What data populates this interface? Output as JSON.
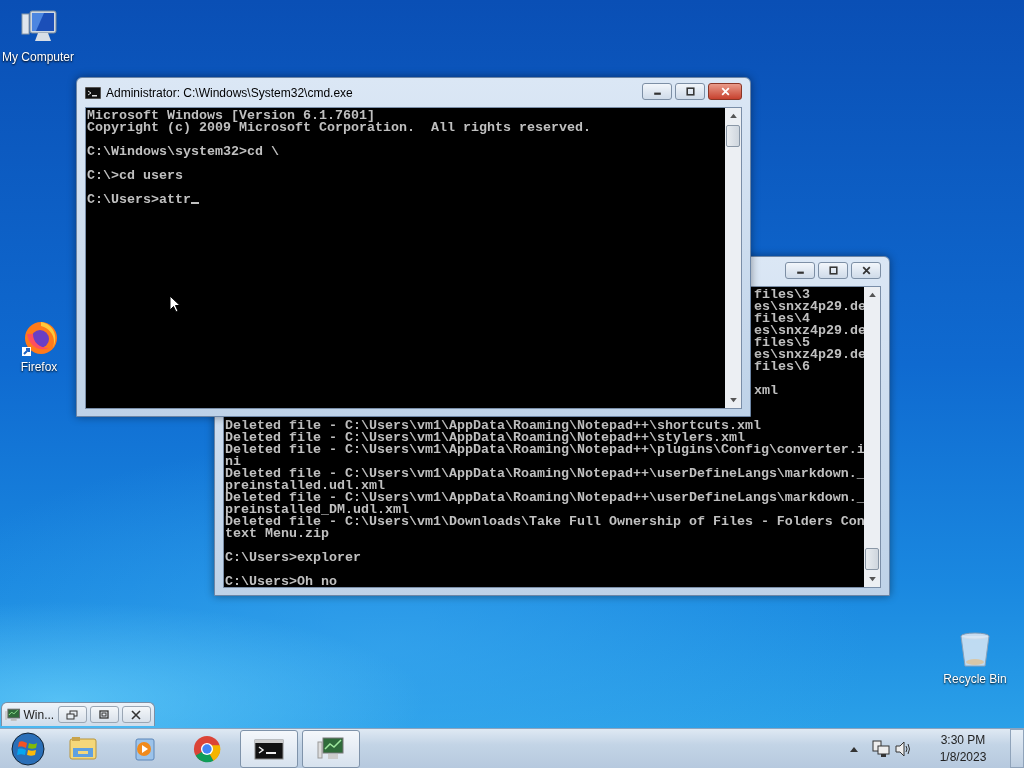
{
  "desktop_icons": [
    {
      "label": "My Computer",
      "kind": "computer"
    },
    {
      "label": "Firefox",
      "kind": "firefox"
    },
    {
      "label": "Recycle Bin",
      "kind": "recycle"
    }
  ],
  "back_console": {
    "strip_blocks": [
      [
        "files\\3",
        "es\\snxz4p29.de",
        "files\\4",
        "es\\snxz4p29.de",
        "files\\5",
        "es\\snxz4p29.de",
        "files\\6"
      ],
      [
        "xml"
      ]
    ],
    "blocks": [
      [
        "Deleted file - C:\\Users\\vm1\\AppData\\Roaming\\Notepad++\\shortcuts.xml",
        "Deleted file - C:\\Users\\vm1\\AppData\\Roaming\\Notepad++\\stylers.xml",
        "Deleted file - C:\\Users\\vm1\\AppData\\Roaming\\Notepad++\\plugins\\Config\\converter.i",
        "ni",
        "Deleted file - C:\\Users\\vm1\\AppData\\Roaming\\Notepad++\\userDefineLangs\\markdown._",
        "preinstalled.udl.xml",
        "Deleted file - C:\\Users\\vm1\\AppData\\Roaming\\Notepad++\\userDefineLangs\\markdown._",
        "preinstalled_DM.udl.xml",
        "Deleted file - C:\\Users\\vm1\\Downloads\\Take Full Ownership of Files - Folders Con",
        "text Menu.zip"
      ],
      [
        "C:\\Users>explorer"
      ],
      [
        "C:\\Users>Oh no"
      ]
    ]
  },
  "front_console": {
    "title": "Administrator: C:\\Windows\\System32\\cmd.exe",
    "cursor": true,
    "blocks": [
      [
        "Microsoft Windows [Version 6.1.7601]",
        "Copyright (c) 2009 Microsoft Corporation.  All rights reserved."
      ],
      [
        "C:\\Windows\\system32>cd \\"
      ],
      [
        "C:\\>cd users"
      ],
      [
        "C:\\Users>attr"
      ]
    ]
  },
  "minimized_window": {
    "title": "Win..."
  },
  "taskbar_items": [
    {
      "kind": "explorer",
      "running": false
    },
    {
      "kind": "media",
      "running": false
    },
    {
      "kind": "chrome",
      "running": false
    },
    {
      "kind": "cmd",
      "running": true
    },
    {
      "kind": "monitor",
      "running": true
    }
  ],
  "clock": {
    "time": "3:30 PM",
    "date": "1/8/2023"
  }
}
